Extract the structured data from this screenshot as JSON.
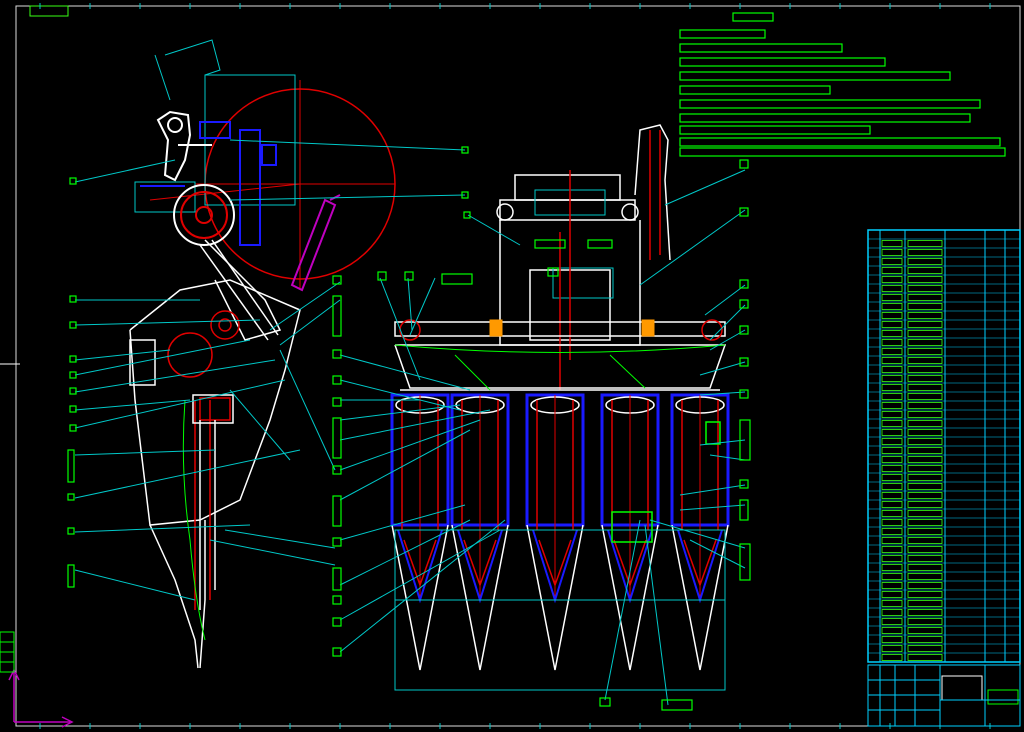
{
  "viewport": {
    "background": "#000000"
  },
  "colors": {
    "frame": "#dcdcdc",
    "leader": "#00c8c8",
    "annotation": "#00ff00",
    "geometry": "#ffffff",
    "centerline": "#e00000",
    "blue": "#1a1aff",
    "magenta": "#c000c0",
    "orange": "#ff9900",
    "table_green": "#39ff14",
    "table_cyan": "#00d0ff",
    "ucs": "#c000c0"
  },
  "icons": {
    "ucs": "ucs-axis-icon",
    "crosshair": "crosshair-cursor-icon"
  }
}
